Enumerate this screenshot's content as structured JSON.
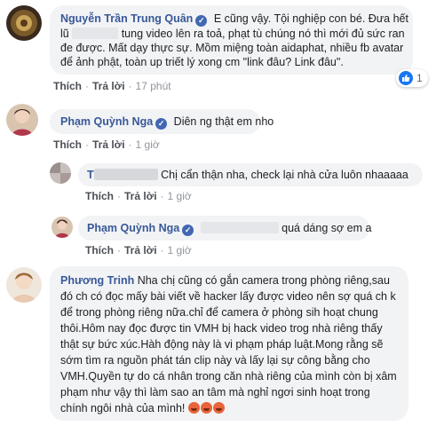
{
  "comments": [
    {
      "author": "Nguyễn Trần Trung Quân",
      "lines": [
        "E cũng vậy. Tội nghiệp con bé. Đưa hết",
        "tung video lên ra toả, phạt tù chúng nó thì mới đủ sức ran",
        "đe được. Mất dạy thực sự. Mồm miệng toàn aidaphat, nhiều fb avatar",
        "để ảnh phật, toàn up triết lý xong cm \"link đâu? Link đâu\"."
      ],
      "line2_prefix": "lũ",
      "actions": {
        "like": "Thích",
        "reply": "Trả lời",
        "time": "17 phút"
      },
      "reaction_count": "1"
    },
    {
      "author": "Phạm Quỳnh Nga",
      "text": "Diên ng thật em nho",
      "actions": {
        "like": "Thích",
        "reply": "Trả lời",
        "time": "1 giờ"
      }
    },
    {
      "author": "T",
      "text": "Chị cẩn thận nha, check lại nhà cửa luôn nhaaaaa",
      "actions": {
        "like": "Thích",
        "reply": "Trả lời",
        "time": "1 giờ"
      }
    },
    {
      "author": "Phạm Quỳnh Nga",
      "text": "quá dáng sợ em a",
      "actions": {
        "like": "Thích",
        "reply": "Trả lời",
        "time": "1 giờ"
      }
    },
    {
      "author": "Phương Trinh",
      "lines": [
        "Nha chị cũng có gắn camera trong phòng riêng,sau",
        "đó ch có đọc mấy bài viết về hacker lấy được video nên sợ quá ch k",
        "để trong phòng riêng nữa.chỉ để camera ở phòng sih hoạt chung",
        "thôi.Hôm nay đọc được tin VMH bị hack video trog nhà riêng thấy",
        "thật sự bức xúc.Hàh động này là vi phạm pháp luật.Mong rằng sẽ",
        "sớm tìm ra nguồn phát tán clip này và lấy lại sự công bằng cho",
        "VMH.Quyền tự do cá nhân trong căn nhà riêng của mình còn bị xâm",
        "phạm như vậy thì làm sao an tâm mà nghỉ ngơi sinh hoạt trong",
        "chính ngôi nhà của mình!"
      ]
    }
  ],
  "icons": {
    "verified": "verified-check-icon",
    "like": "thumbs-up-icon",
    "emoji": "angry-face-emoji"
  },
  "colors": {
    "name": "#385898",
    "bubble": "#f2f3f5",
    "like_blue": "#1877f2"
  }
}
